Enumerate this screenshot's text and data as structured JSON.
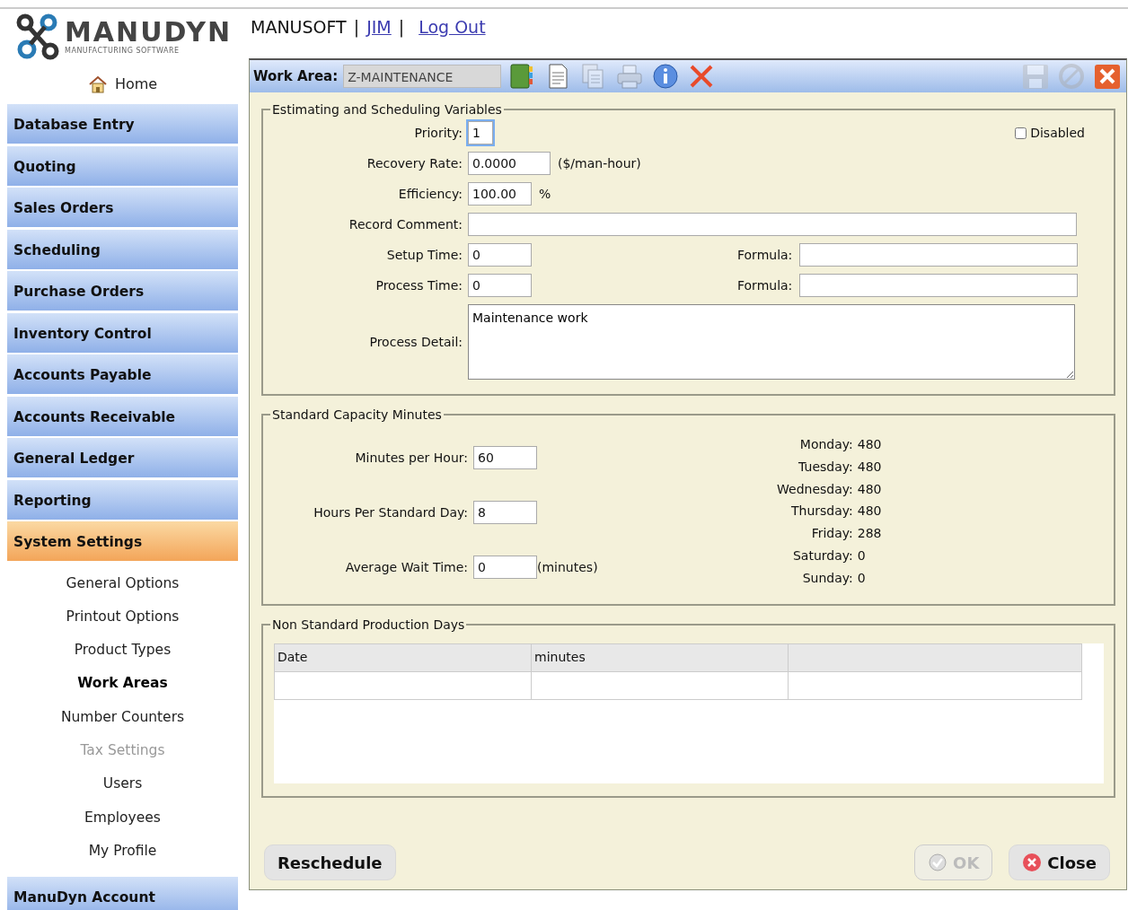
{
  "logo": {
    "text": "MANUDYN",
    "tagline": "MANUFACTURING SOFTWARE"
  },
  "header": [
    {
      "kind": "text",
      "text": "MANUSOFT"
    },
    {
      "kind": "sep",
      "text": "|"
    },
    {
      "kind": "link",
      "text": "JIM"
    },
    {
      "kind": "sep",
      "text": "|"
    },
    {
      "kind": "link",
      "text": "Log Out"
    }
  ],
  "home": "Home",
  "sidebar": [
    {
      "label": "Database Entry",
      "selected": false
    },
    {
      "label": "Quoting",
      "selected": false
    },
    {
      "label": "Sales Orders",
      "selected": false
    },
    {
      "label": "Scheduling",
      "selected": false
    },
    {
      "label": "Purchase Orders",
      "selected": false
    },
    {
      "label": "Inventory Control",
      "selected": false
    },
    {
      "label": "Accounts Payable",
      "selected": false
    },
    {
      "label": "Accounts Receivable",
      "selected": false
    },
    {
      "label": "General Ledger",
      "selected": false
    },
    {
      "label": "Reporting",
      "selected": false
    },
    {
      "label": "System Settings",
      "selected": true,
      "children": [
        {
          "label": "General Options",
          "selected": false,
          "disabled": false
        },
        {
          "label": "Printout Options",
          "selected": false,
          "disabled": false
        },
        {
          "label": "Product Types",
          "selected": false,
          "disabled": false
        },
        {
          "label": "Work Areas",
          "selected": true,
          "disabled": false
        },
        {
          "label": "Number Counters",
          "selected": false,
          "disabled": false
        },
        {
          "label": "Tax Settings",
          "selected": false,
          "disabled": true
        },
        {
          "label": "Users",
          "selected": false,
          "disabled": false
        },
        {
          "label": "Employees",
          "selected": false,
          "disabled": false
        },
        {
          "label": "My Profile",
          "selected": false,
          "disabled": false
        }
      ]
    },
    {
      "label": "ManuDyn Account",
      "selected": false
    }
  ],
  "toolbar": {
    "label": "Work Area:",
    "value": "Z-MAINTENANCE",
    "tools": [
      {
        "kind": "book",
        "disabled": false
      },
      {
        "kind": "document",
        "disabled": false
      },
      {
        "kind": "copy",
        "disabled": true
      },
      {
        "kind": "print",
        "disabled": true
      },
      {
        "kind": "info",
        "disabled": false
      },
      {
        "kind": "delete",
        "disabled": false
      }
    ],
    "right_tools": [
      {
        "kind": "save",
        "disabled": true
      },
      {
        "kind": "cancel",
        "disabled": true
      },
      {
        "kind": "close",
        "disabled": false
      }
    ]
  },
  "estimating": {
    "legend": "Estimating and Scheduling Variables",
    "disabled_checkbox": {
      "label": "Disabled",
      "checked": false
    },
    "fields": [
      {
        "label": "Priority:",
        "value": "1",
        "kind": "tiny",
        "focused": true
      },
      {
        "label": "Recovery Rate:",
        "value": "0.0000",
        "kind": "medium",
        "unit": "($/man-hour)"
      },
      {
        "label": "Efficiency:",
        "value": "100.00",
        "kind": "short",
        "unit": "%"
      },
      {
        "label": "Record Comment:",
        "kind": "wide"
      },
      {
        "label": "Setup Time:",
        "value": "0",
        "kind": "short",
        "formula": {
          "label": "Formula:"
        }
      },
      {
        "label": "Process Time:",
        "value": "0",
        "kind": "short",
        "formula": {
          "label": "Formula:"
        }
      },
      {
        "label": "Process Detail:",
        "value": "Maintenance work",
        "kind": "textarea"
      }
    ]
  },
  "capacity": {
    "legend": "Standard Capacity Minutes",
    "fields": [
      {
        "label": "Minutes per Hour:",
        "value": "60"
      },
      {
        "label": "Hours Per Standard Day:",
        "value": "8"
      },
      {
        "label": "Average Wait Time:",
        "value": "0",
        "unit": "(minutes)"
      }
    ],
    "days": [
      {
        "label": "Monday:",
        "value": "480"
      },
      {
        "label": "Tuesday:",
        "value": "480"
      },
      {
        "label": "Wednesday:",
        "value": "480"
      },
      {
        "label": "Thursday:",
        "value": "480"
      },
      {
        "label": "Friday:",
        "value": "288"
      },
      {
        "label": "Saturday:",
        "value": "0"
      },
      {
        "label": "Sunday:",
        "value": "0"
      }
    ]
  },
  "non_standard": {
    "legend": "Non Standard Production Days",
    "columns": [
      "Date",
      "minutes"
    ]
  },
  "buttons": [
    {
      "label": "Reschedule",
      "kind": "plain",
      "disabled": false
    },
    {
      "label": "OK",
      "kind": "ok",
      "disabled": true
    },
    {
      "label": "Close",
      "kind": "close",
      "disabled": false
    }
  ]
}
